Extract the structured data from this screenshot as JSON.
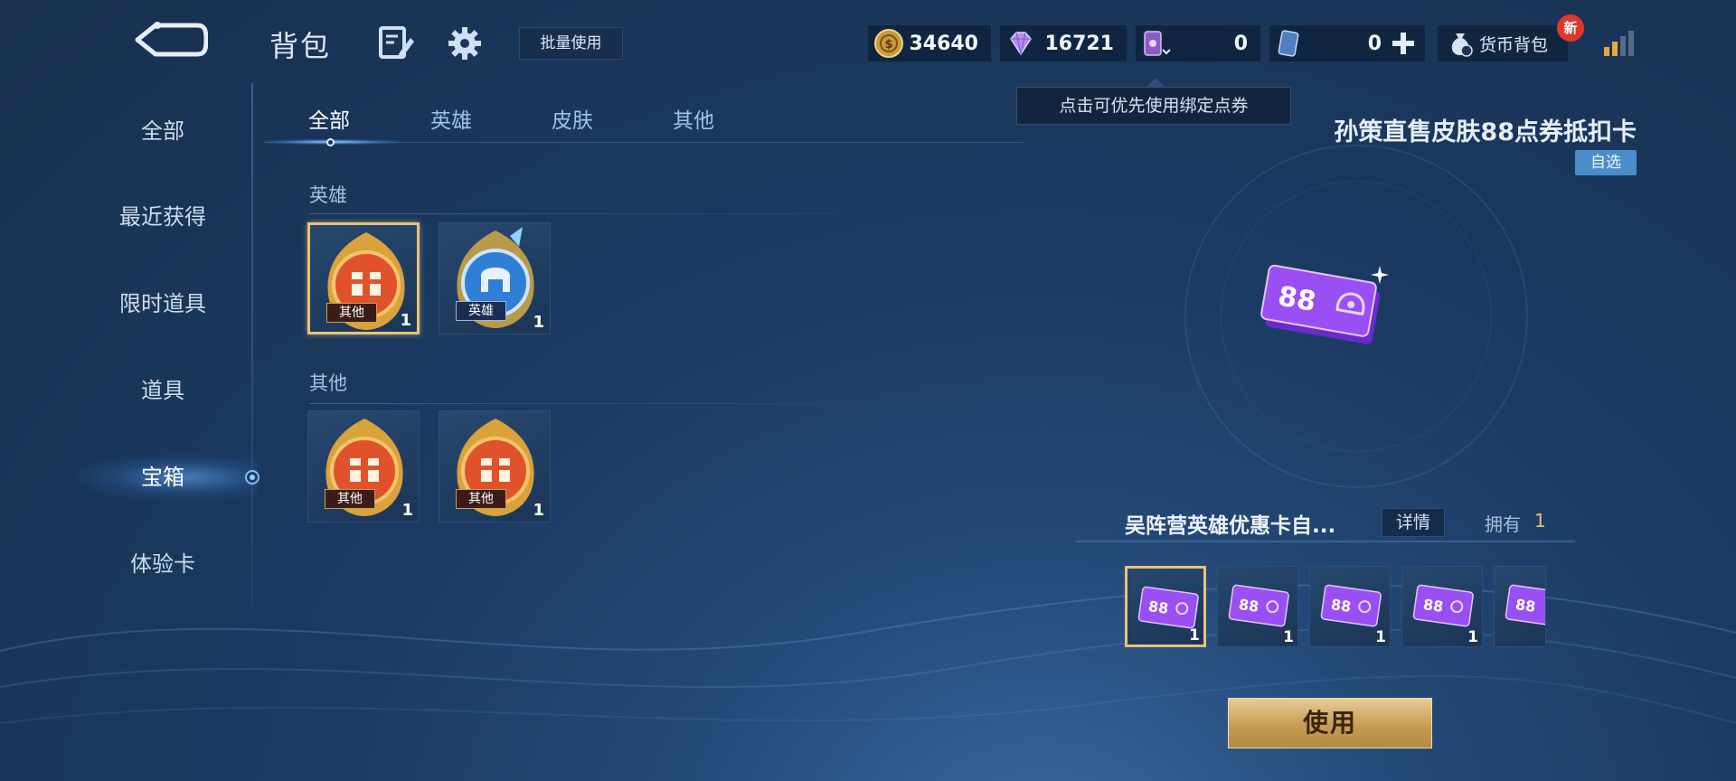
{
  "header": {
    "title": "背包",
    "batch_use_label": "批量使用",
    "currencies": {
      "coins": "34640",
      "gems": "16721",
      "vouchers": "0",
      "cards": "0"
    },
    "wallet_label": "货币背包",
    "new_badge": "新",
    "tooltip": "点击可优先使用绑定点券"
  },
  "sidebar": {
    "items": [
      {
        "label": "全部"
      },
      {
        "label": "最近获得"
      },
      {
        "label": "限时道具"
      },
      {
        "label": "道具"
      },
      {
        "label": "宝箱"
      },
      {
        "label": "体验卡"
      }
    ],
    "active_index": 4
  },
  "tabs": [
    {
      "label": "全部"
    },
    {
      "label": "英雄"
    },
    {
      "label": "皮肤"
    },
    {
      "label": "其他"
    }
  ],
  "sections": [
    {
      "label": "英雄",
      "items": [
        {
          "tag": "其他",
          "count": "1",
          "icon": "gift-chest-icon"
        },
        {
          "tag": "英雄",
          "count": "1",
          "icon": "hero-chest-icon"
        }
      ]
    },
    {
      "label": "其他",
      "items": [
        {
          "tag": "其他",
          "count": "1",
          "icon": "gift-chest-icon"
        },
        {
          "tag": "其他",
          "count": "1",
          "icon": "gift-chest-icon"
        }
      ]
    }
  ],
  "detail": {
    "title": "孙策直售皮肤88点券抵扣卡",
    "tag": "自选",
    "ticket_number": "88",
    "group_name": "吴阵营英雄优惠卡自...",
    "details_label": "详情",
    "own_label": "拥有",
    "own_count": "1",
    "options": [
      {
        "label": "88",
        "count": "1"
      },
      {
        "label": "88",
        "count": "1"
      },
      {
        "label": "88",
        "count": "1"
      },
      {
        "label": "88",
        "count": "1"
      },
      {
        "label": "88",
        "count": ""
      }
    ],
    "use_label": "使用"
  },
  "colors": {
    "accent_gold": "#e9c27a",
    "voucher_purple": "#8b3ff0",
    "detail_tag_blue": "#4a8ec9"
  }
}
